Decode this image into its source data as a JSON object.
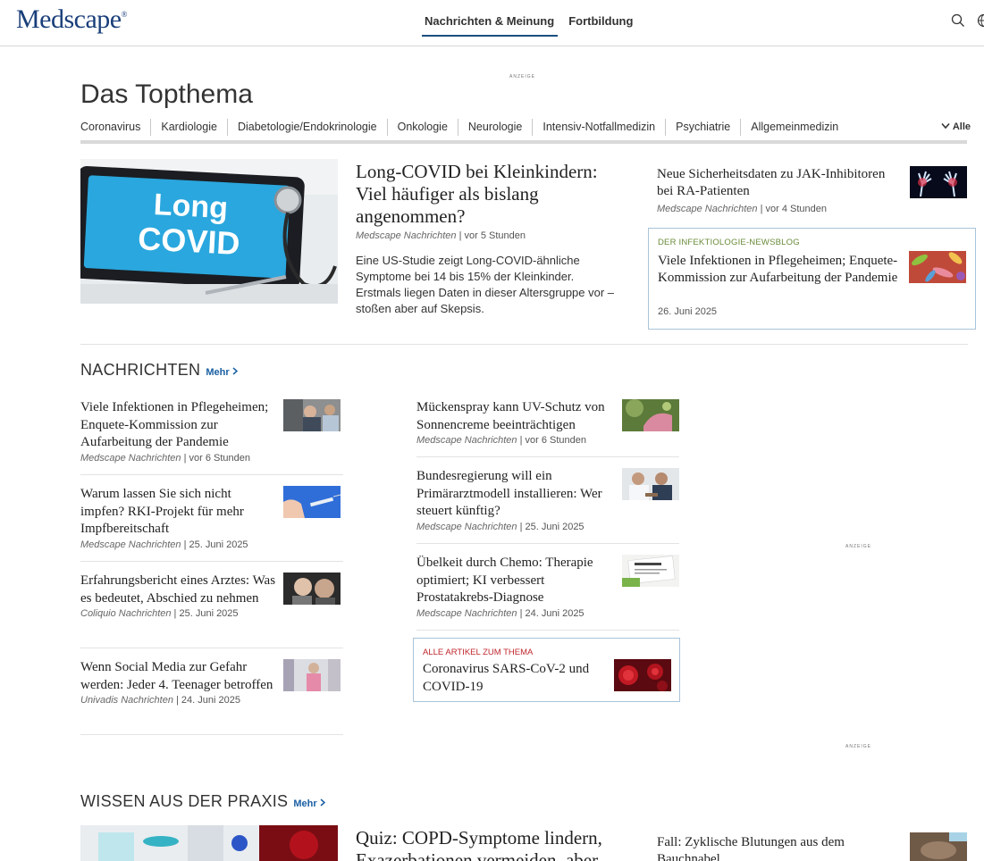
{
  "header": {
    "logo_text": "Medscape",
    "logo_reg": "®",
    "nav": [
      "Nachrichten & Meinung",
      "Fortbildung"
    ]
  },
  "ads": {
    "label": "ANZEIGE"
  },
  "topthema": {
    "title": "Das Topthema",
    "topics": [
      "Coronavirus",
      "Kardiologie",
      "Diabetologie/Endokrinologie",
      "Onkologie",
      "Neurologie",
      "Intensiv-Notfallmedizin",
      "Psychiatrie",
      "Allgemeinmedizin"
    ],
    "all_label": "Alle",
    "hero": {
      "image_text_1": "Long",
      "image_text_2": "COVID",
      "title": "Long-COVID bei Kleinkindern: Viel häufiger als bislang angenommen?",
      "source": "Medscape Nachrichten",
      "time": "vor 5 Stunden",
      "description": "Eine US-Studie zeigt Long-COVID-ähnliche Symptome bei 14 bis 15% der Kleinkinder. Erstmals liegen Daten in dieser Altersgruppe vor – stoßen aber auf Skepsis."
    },
    "side": {
      "title": "Neue Sicherheitsdaten zu JAK-Inhibitoren bei RA-Patienten",
      "source": "Medscape Nachrichten",
      "time": "vor 4 Stunden"
    },
    "blog": {
      "label": "DER INFEKTIOLOGIE-NEWSBLOG",
      "title": "Viele Infektionen in Pflegeheimen; Enquete-Kommission zur Aufarbeitung der Pandemie",
      "date": "26. Juni 2025"
    }
  },
  "news": {
    "title": "NACHRICHTEN",
    "more_label": "Mehr",
    "left": [
      {
        "title": "Viele Infektionen in Pflegeheimen; Enquete-Kommission zur Aufarbeitung der Pandemie",
        "source": "Medscape Nachrichten",
        "time": "vor 6 Stunden"
      },
      {
        "title": "Warum lassen Sie sich nicht impfen? RKI-Projekt für mehr Impfbereitschaft",
        "source": "Medscape Nachrichten",
        "time": "25. Juni 2025"
      },
      {
        "title": "Erfahrungsbericht eines Arztes: Was es bedeutet, Abschied zu nehmen",
        "source": "Coliquio Nachrichten",
        "time": "25. Juni 2025"
      },
      {
        "title": "Wenn Social Media zur Gefahr werden: Jeder 4. Teenager betroffen",
        "source": "Univadis Nachrichten",
        "time": "24. Juni 2025"
      }
    ],
    "right": [
      {
        "title": "Mückenspray kann UV-Schutz von Sonnencreme beeinträchtigen",
        "source": "Medscape Nachrichten",
        "time": "vor 6 Stunden"
      },
      {
        "title": "Bundesregierung will ein Primärarztmodell installieren: Wer steuert künftig?",
        "source": "Medscape Nachrichten",
        "time": "25. Juni 2025"
      },
      {
        "title": "Übelkeit durch Chemo: Therapie optimiert; KI verbessert Prostatakrebs-Diagnose",
        "source": "Medscape Nachrichten",
        "time": "24. Juni 2025"
      }
    ],
    "all_articles": {
      "label": "ALLE ARTIKEL ZUM THEMA",
      "title": "Coronavirus SARS-CoV-2 und COVID-19"
    }
  },
  "praxis": {
    "title": "WISSEN AUS DER PRAXIS",
    "more_label": "Mehr",
    "main_title": "Quiz: COPD-Symptome lindern, Exazerbationen vermeiden, aber",
    "side_title": "Fall: Zyklische Blutungen aus dem Bauchnabel"
  },
  "colors": {
    "brand": "#1a3f7a",
    "link": "#1a5fa3",
    "blog_label": "#6a8b3a",
    "all_label": "#c0272d",
    "box_border": "#a9c4d9"
  }
}
